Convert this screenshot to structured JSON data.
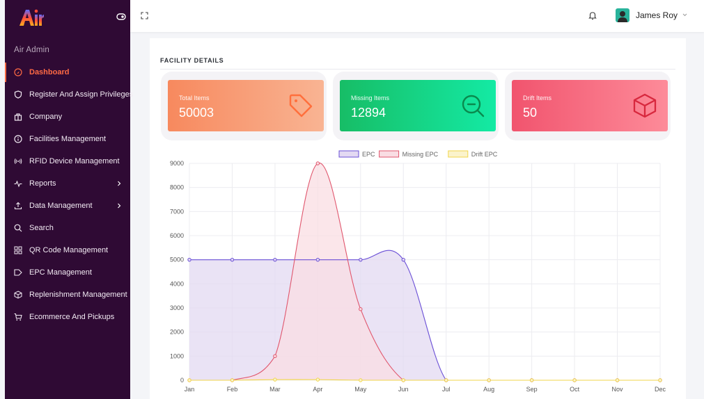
{
  "sidebar": {
    "app_name": "Air Admin",
    "items": [
      {
        "label": "Dashboard",
        "icon": "dashboard-icon",
        "active": true
      },
      {
        "label": "Register And Assign Privileges",
        "icon": "shield-icon"
      },
      {
        "label": "Company",
        "icon": "building-icon"
      },
      {
        "label": "Facilities Management",
        "icon": "info-icon"
      },
      {
        "label": "RFID Device Management",
        "icon": "rfid-icon"
      },
      {
        "label": "Reports",
        "icon": "activity-icon",
        "has_submenu": true
      },
      {
        "label": "Data Management",
        "icon": "upload-icon",
        "has_submenu": true
      },
      {
        "label": "Search",
        "icon": "search-icon"
      },
      {
        "label": "QR Code Management",
        "icon": "qr-code-icon"
      },
      {
        "label": "EPC Management",
        "icon": "tag-icon"
      },
      {
        "label": "Replenishment Management",
        "icon": "box-icon"
      },
      {
        "label": "Ecommerce And Pickups",
        "icon": "cart-icon"
      }
    ]
  },
  "topbar": {
    "user_name": "James Roy",
    "icons": [
      "expand-icon",
      "bell-icon",
      "chevron-down-icon"
    ]
  },
  "main": {
    "section_title": "FACILITY DETAILS",
    "stats": [
      {
        "label": "Total Items",
        "value": "50003",
        "icon": "tag-icon",
        "color_from": "#f7895e",
        "color_to": "#f9b493"
      },
      {
        "label": "Missing Items",
        "value": "12894",
        "icon": "zoom-out-icon",
        "color_from": "#17bd66",
        "color_to": "#14eaa4"
      },
      {
        "label": "Drift Items",
        "value": "50",
        "icon": "box-icon",
        "color_from": "#f1546e",
        "color_to": "#fd8b99"
      }
    ]
  },
  "chart_data": {
    "type": "area",
    "categories": [
      "Jan",
      "Feb",
      "Mar",
      "Apr",
      "May",
      "Jun",
      "Jul",
      "Aug",
      "Sep",
      "Oct",
      "Nov",
      "Dec"
    ],
    "ylim": [
      0,
      9000
    ],
    "yticks": [
      0,
      1000,
      2000,
      3000,
      4000,
      5000,
      6000,
      7000,
      8000,
      9000
    ],
    "grid": true,
    "legend_position": "top",
    "series": [
      {
        "name": "EPC",
        "values": [
          5000,
          5000,
          5000,
          5000,
          5000,
          5000,
          0,
          0,
          0,
          0,
          0,
          0
        ],
        "stroke": "#6a4fd6",
        "fill": "#e3d9f2"
      },
      {
        "name": "Missing EPC",
        "values": [
          0,
          0,
          1000,
          9000,
          2950,
          0,
          0,
          0,
          0,
          0,
          0,
          0
        ],
        "stroke": "#e0566d",
        "fill": "#f9dde3"
      },
      {
        "name": "Drift EPC",
        "values": [
          0,
          0,
          25,
          25,
          0,
          0,
          0,
          0,
          0,
          0,
          0,
          0
        ],
        "stroke": "#f0d64a",
        "fill": "#fbf3cc"
      }
    ]
  }
}
